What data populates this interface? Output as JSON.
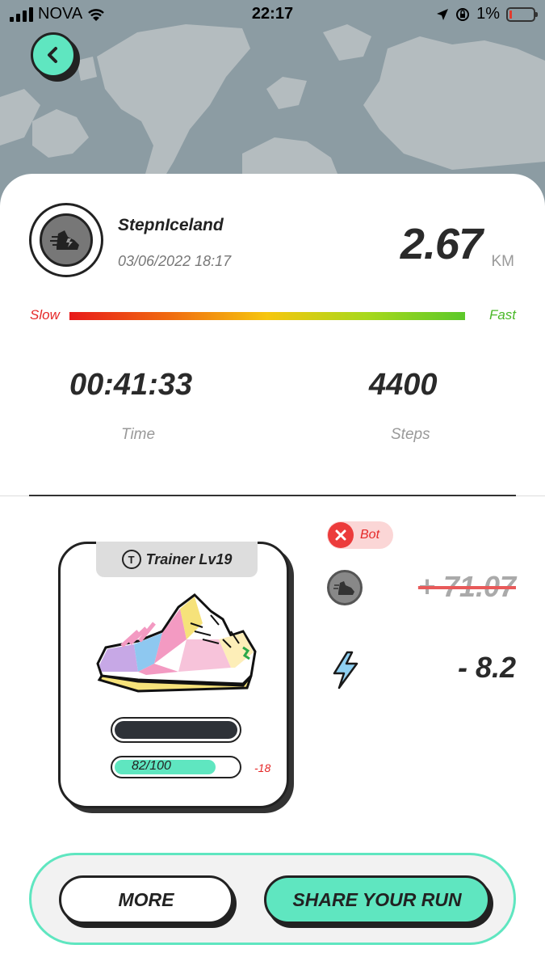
{
  "status_bar": {
    "carrier": "NOVA",
    "time": "22:17",
    "battery_percent": "1%"
  },
  "run": {
    "username": "StepnIceland",
    "datetime": "03/06/2022 18:17",
    "distance": "2.67",
    "distance_unit": "KM",
    "speed_slow_label": "Slow",
    "speed_fast_label": "Fast",
    "time_value": "00:41:33",
    "time_label": "Time",
    "steps_value": "4400",
    "steps_label": "Steps"
  },
  "sneaker": {
    "tag_icon_letter": "T",
    "type_level": "Trainer Lv19",
    "durability": "82/100",
    "durability_fraction": 0.82,
    "durability_delta": "-18"
  },
  "rewards": {
    "bot_label": "Bot",
    "gst_value": "+ 71.07",
    "energy_value": "- 8.2"
  },
  "actions": {
    "more_label": "MORE",
    "share_label": "SHARE YOUR RUN"
  },
  "colors": {
    "accent": "#5fe6c0",
    "slow": "#e52828",
    "fast": "#4ab828"
  }
}
